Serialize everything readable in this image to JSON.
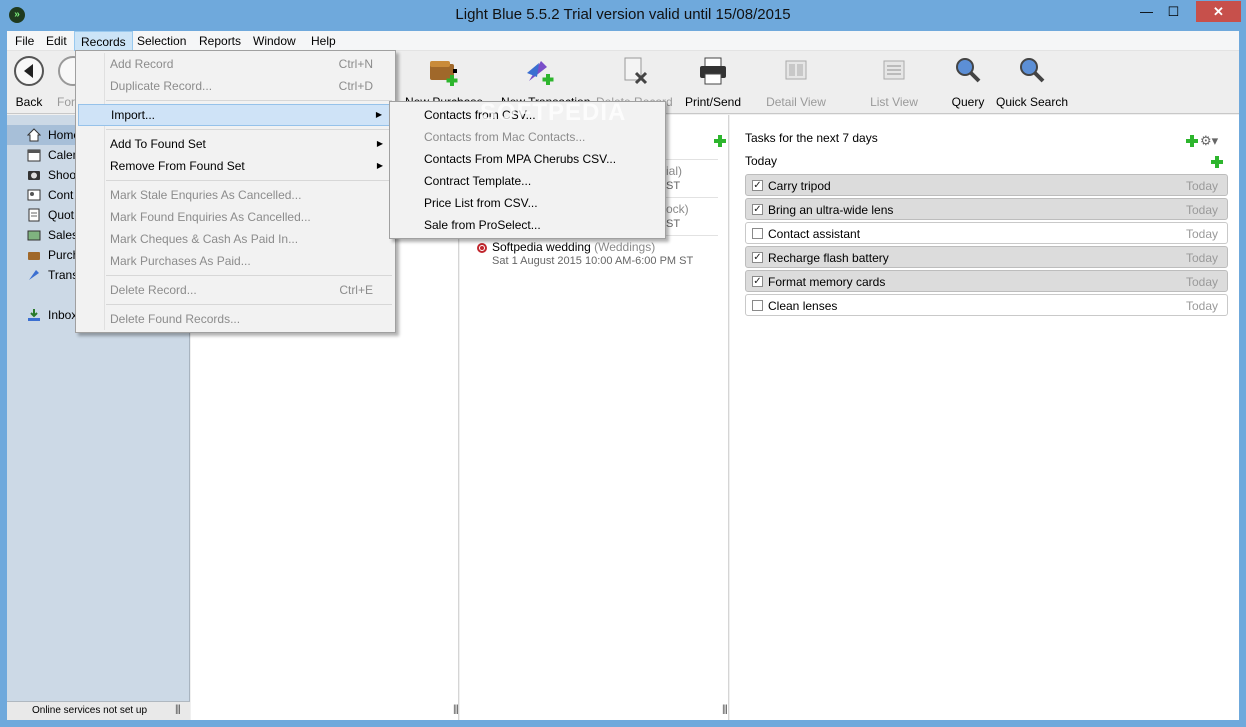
{
  "window": {
    "title": "Light Blue 5.5.2    Trial version valid until 15/08/2015",
    "min": "—",
    "max": "☐",
    "close": "✕"
  },
  "menubar": [
    "File",
    "Edit",
    "Records",
    "Selection",
    "Reports",
    "Window",
    "Help"
  ],
  "toolbar": {
    "back": "Back",
    "forward": "For",
    "new_purchase": "New Purchase",
    "new_transaction": "New Transaction",
    "delete_record": "Delete Record",
    "print_send": "Print/Send",
    "detail_view": "Detail View",
    "list_view": "List View",
    "query": "Query",
    "quick_search": "Quick Search"
  },
  "sidebar": {
    "items": [
      "Home",
      "Calen",
      "Shoo",
      "Cont",
      "Quot",
      "Sales",
      "Purch",
      "Trans",
      "Inbox"
    ],
    "status": "Online services not set up"
  },
  "events": [
    {
      "title_fragment": "ial)",
      "time_fragment": "ST"
    },
    {
      "title_fragment": "ock)",
      "time_fragment": "ST"
    },
    {
      "title": "Softpedia wedding",
      "category": "(Weddings)",
      "time": "Sat 1 August 2015 10:00 AM-6:00 PM ST"
    }
  ],
  "tasks": {
    "title": "Tasks for the next 7 days",
    "group": "Today",
    "items": [
      {
        "label": "Carry tripod",
        "due": "Today",
        "done": true
      },
      {
        "label": "Bring an ultra-wide lens",
        "due": "Today",
        "done": true
      },
      {
        "label": "Contact assistant",
        "due": "Today",
        "done": false
      },
      {
        "label": "Recharge flash battery",
        "due": "Today",
        "done": true
      },
      {
        "label": "Format memory cards",
        "due": "Today",
        "done": true
      },
      {
        "label": "Clean lenses",
        "due": "Today",
        "done": false
      }
    ]
  },
  "records_menu": {
    "add_record": "Add Record",
    "add_record_sc": "Ctrl+N",
    "duplicate_record": "Duplicate Record...",
    "duplicate_record_sc": "Ctrl+D",
    "import": "Import...",
    "add_to_found_set": "Add To Found Set",
    "remove_from_found_set": "Remove From Found Set",
    "mark_stale": "Mark Stale Enquries As Cancelled...",
    "mark_found": "Mark Found Enquiries As Cancelled...",
    "mark_cheques": "Mark Cheques & Cash As Paid In...",
    "mark_purchases": "Mark Purchases As Paid...",
    "delete_record": "Delete Record...",
    "delete_record_sc": "Ctrl+E",
    "delete_found": "Delete Found Records..."
  },
  "import_submenu": [
    {
      "label": "Contacts from CSV...",
      "enabled": true
    },
    {
      "label": "Contacts from Mac Contacts...",
      "enabled": false
    },
    {
      "label": "Contacts From MPA Cherubs CSV...",
      "enabled": true
    },
    {
      "label": "Contract Template...",
      "enabled": true
    },
    {
      "label": "Price List from CSV...",
      "enabled": true
    },
    {
      "label": "Sale from ProSelect...",
      "enabled": true
    }
  ],
  "watermark": "SOFTPEDIA",
  "colors": {
    "titlebar": "#6fa9dc",
    "sidebar": "#ccd9e6",
    "accent_green": "#2db52d",
    "event_red": "#c0262d"
  }
}
